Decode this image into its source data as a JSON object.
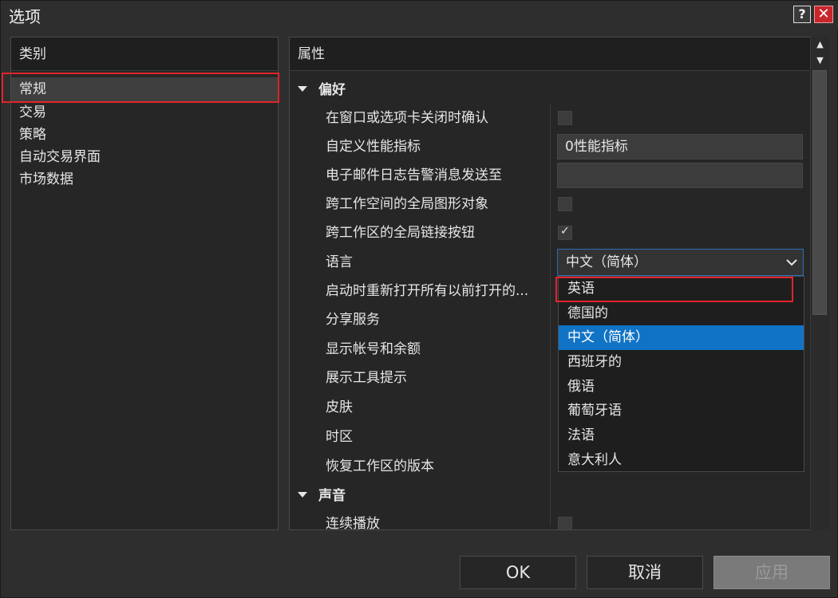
{
  "window": {
    "title": "选项",
    "help_label": "?",
    "close_label": "✕"
  },
  "categories": {
    "header": "类别",
    "items": [
      {
        "label": "常规",
        "selected": true
      },
      {
        "label": "交易",
        "selected": false
      },
      {
        "label": "策略",
        "selected": false
      },
      {
        "label": "自动交易界面",
        "selected": false
      },
      {
        "label": "市场数据",
        "selected": false
      }
    ]
  },
  "properties": {
    "header": "属性",
    "sections": [
      {
        "title": "偏好",
        "rows": [
          {
            "label": "在窗口或选项卡关闭时确认",
            "control": "checkbox",
            "checked": false
          },
          {
            "label": "自定义性能指标",
            "control": "text",
            "value": "0性能指标"
          },
          {
            "label": "电子邮件日志告警消息发送至",
            "control": "text",
            "value": ""
          },
          {
            "label": "跨工作空间的全局图形对象",
            "control": "checkbox",
            "checked": false
          },
          {
            "label": "跨工作区的全局链接按钮",
            "control": "checkbox",
            "checked": true
          },
          {
            "label": "语言",
            "control": "select",
            "value": "中文（简体）"
          },
          {
            "label": "启动时重新打开所有以前打开的...",
            "control": "none"
          },
          {
            "label": "分享服务",
            "control": "none"
          },
          {
            "label": "显示帐号和余额",
            "control": "none"
          },
          {
            "label": "展示工具提示",
            "control": "none"
          },
          {
            "label": "皮肤",
            "control": "none"
          },
          {
            "label": "时区",
            "control": "none"
          },
          {
            "label": "恢复工作区的版本",
            "control": "none"
          }
        ]
      },
      {
        "title": "声音",
        "rows": [
          {
            "label": "连续播放",
            "control": "checkbox",
            "checked": false
          }
        ]
      }
    ]
  },
  "language_dropdown": {
    "options": [
      "英语",
      "德国的",
      "中文（简体）",
      "西班牙的",
      "俄语",
      "葡萄牙语",
      "法语",
      "意大利人"
    ],
    "selected": "中文（简体）"
  },
  "buttons": {
    "ok": "OK",
    "cancel": "取消",
    "apply": "应用"
  },
  "colors": {
    "selection_blue": "#1173c5",
    "highlight_red": "#e0242b",
    "close_red": "#c8262b"
  }
}
